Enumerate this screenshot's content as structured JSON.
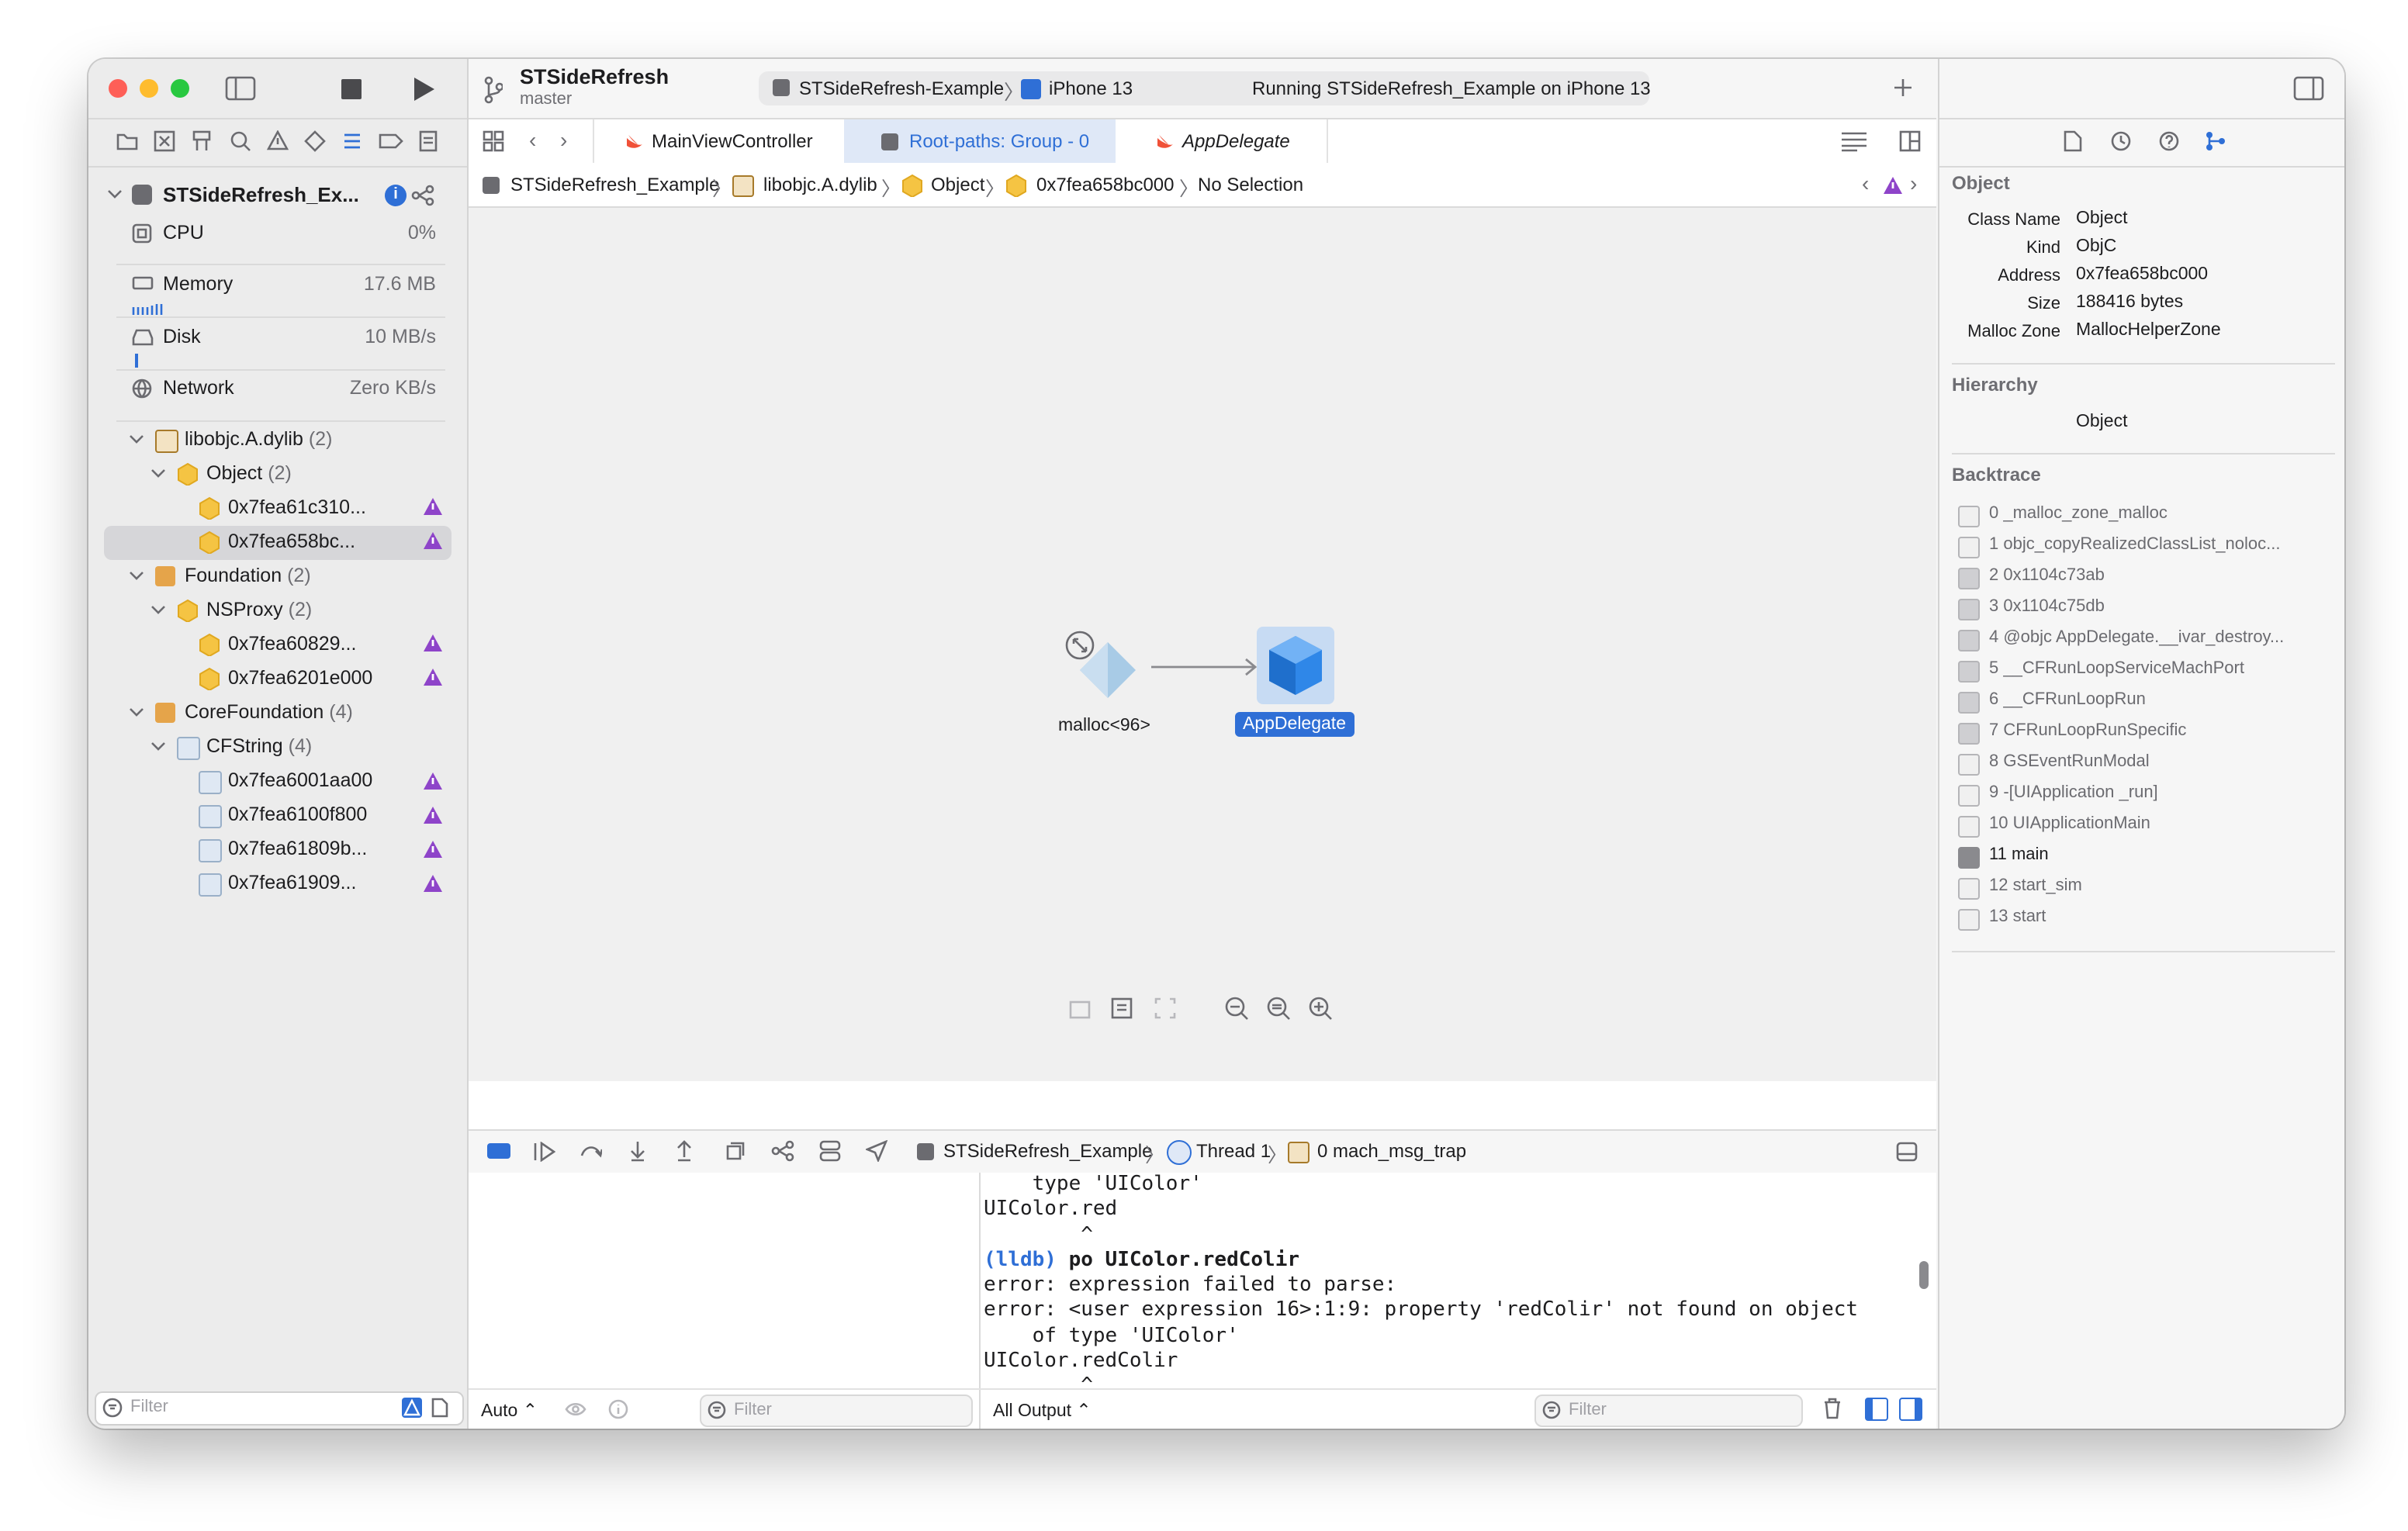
{
  "toolbar": {
    "project_name": "STSideRefresh",
    "branch": "master",
    "scheme": "STSideRefresh-Example",
    "device": "iPhone 13",
    "status": "Running STSideRefresh_Example on iPhone 13"
  },
  "tabs": [
    {
      "label": "MainViewController"
    },
    {
      "label": "Root-paths: Group - 0"
    },
    {
      "label": "AppDelegate"
    }
  ],
  "jumpbar": {
    "items": [
      "STSideRefresh_Example",
      "libobjc.A.dylib",
      "Object",
      "0x7fea658bc000",
      "No Selection"
    ]
  },
  "navigator": {
    "process": "STSideRefresh_Ex...",
    "gauges": [
      {
        "label": "CPU",
        "value": "0%"
      },
      {
        "label": "Memory",
        "value": "17.6 MB"
      },
      {
        "label": "Disk",
        "value": "10 MB/s"
      },
      {
        "label": "Network",
        "value": "Zero KB/s"
      }
    ],
    "tree": {
      "lib1": "libobjc.A.dylib",
      "lib1_count": "(2)",
      "obj": "Object",
      "obj_count": "(2)",
      "obj_a": "0x7fea61c310...",
      "obj_b": "0x7fea658bc...",
      "lib2": "Foundation",
      "lib2_count": "(2)",
      "proxy": "NSProxy",
      "proxy_count": "(2)",
      "proxy_a": "0x7fea60829...",
      "proxy_b": "0x7fea6201e000",
      "lib3": "CoreFoundation",
      "lib3_count": "(4)",
      "cfs": "CFString",
      "cfs_count": "(4)",
      "cfs_a": "0x7fea6001aa00",
      "cfs_b": "0x7fea6100f800",
      "cfs_c": "0x7fea61809b...",
      "cfs_d": "0x7fea61909..."
    },
    "filter_placeholder": "Filter"
  },
  "graph": {
    "node_left": "malloc<96>",
    "node_right": "AppDelegate"
  },
  "debug_bar": {
    "target": "STSideRefresh_Example",
    "thread": "Thread 1",
    "frame": "0 mach_msg_trap"
  },
  "console": {
    "lines": [
      "    type 'UIColor'",
      "UIColor.red",
      "        ^",
      "",
      "error: expression failed to parse:",
      "error: <user expression 16>:1:9: property 'redColir' not found on object",
      "    of type 'UIColor'",
      "UIColor.redColir",
      "        ^"
    ],
    "prompt": "(lldb)",
    "command": "po UIColor.redColir",
    "variables_mode": "Auto",
    "output_mode": "All Output",
    "filter_placeholder": "Filter"
  },
  "inspector": {
    "object_header": "Object",
    "fields": [
      {
        "label": "Class Name",
        "value": "Object"
      },
      {
        "label": "Kind",
        "value": "ObjC"
      },
      {
        "label": "Address",
        "value": "0x7fea658bc000"
      },
      {
        "label": "Size",
        "value": "188416 bytes"
      },
      {
        "label": "Malloc Zone",
        "value": "MallocHelperZone"
      }
    ],
    "hierarchy_header": "Hierarchy",
    "hierarchy_value": "Object",
    "backtrace_header": "Backtrace",
    "backtrace": [
      "0 _malloc_zone_malloc",
      "1 objc_copyRealizedClassList_noloc...",
      "2 0x1104c73ab",
      "3 0x1104c75db",
      "4 @objc AppDelegate.__ivar_destroy...",
      "5 __CFRunLoopServiceMachPort",
      "6 __CFRunLoopRun",
      "7 CFRunLoopRunSpecific",
      "8 GSEventRunModal",
      "9 -[UIApplication _run]",
      "10 UIApplicationMain",
      "11 main",
      "12 start_sim",
      "13 start"
    ]
  },
  "colors": {
    "accent": "#2f6fd6",
    "warning": "#8e44c9",
    "object_yellow": "#f5c443",
    "selection": "#d6d6d9"
  }
}
